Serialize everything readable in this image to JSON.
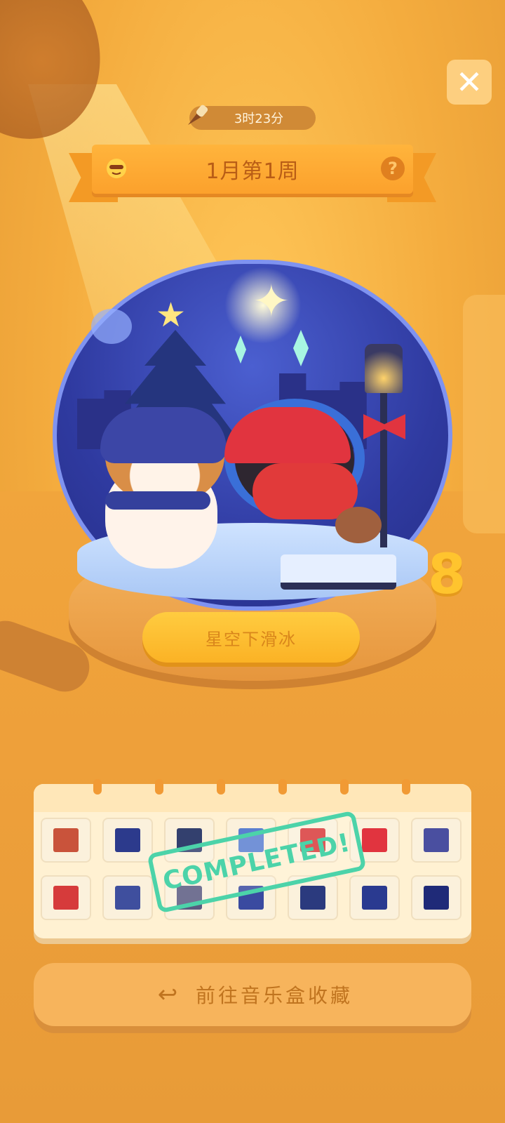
{
  "timer": {
    "text": "3时23分",
    "icon": "paintbrush-icon"
  },
  "header": {
    "title": "1月第1周",
    "left_icon": "sun-face-icon",
    "help_label": "?"
  },
  "globe": {
    "name_plate": "星空下滑冰",
    "level": "8"
  },
  "collection": {
    "rows": [
      [
        "robin-santa",
        "city-skyline",
        "snowman-hat",
        "snowy-roof",
        "red-hat",
        "red-bow",
        "frame"
      ],
      [
        "black-cat-cap",
        "bench",
        "lamp",
        "dog-hat",
        "pine-tree",
        "blue-hat",
        "night-sky"
      ]
    ],
    "stamp": "COMPLETED!"
  },
  "bottom_button": {
    "label": "前往音乐盒收藏",
    "icon": "return-arrow-icon"
  },
  "colors": {
    "background": "#f4ac3e",
    "ribbon": "#fca12c",
    "stamp": "#4cd3a9",
    "globe": "#2f3aa0"
  }
}
